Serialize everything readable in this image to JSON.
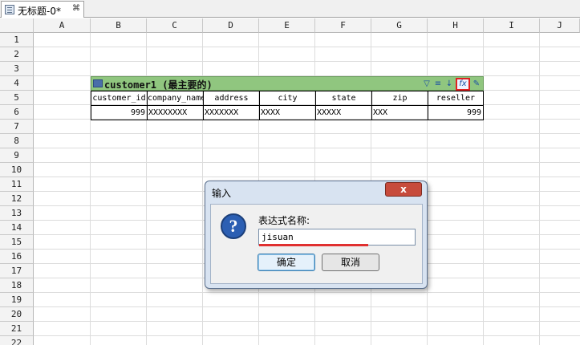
{
  "tab": {
    "title": "无标题-0*",
    "close": "⌘"
  },
  "columns": [
    "A",
    "B",
    "C",
    "D",
    "E",
    "F",
    "G",
    "H",
    "I",
    "J"
  ],
  "rows": [
    "1",
    "2",
    "3",
    "4",
    "5",
    "6",
    "7",
    "8",
    "9",
    "10",
    "11",
    "12",
    "13",
    "14",
    "15",
    "16",
    "17",
    "18",
    "19",
    "20",
    "21",
    "22"
  ],
  "dataset": {
    "title": "customer1 (最主要的)",
    "tools": [
      "filter-icon",
      "list-icon",
      "down-arrow-icon",
      "fx-icon",
      "edit-icon"
    ]
  },
  "table": {
    "headers": [
      "customer_id",
      "company_name",
      "address",
      "city",
      "state",
      "zip",
      "reseller"
    ],
    "row": [
      "999",
      "XXXXXXXX",
      "XXXXXXX",
      "XXXX",
      "XXXXX",
      "XXX",
      "999"
    ]
  },
  "dialog": {
    "title": "输入",
    "close": "x",
    "prompt": "表达式名称:",
    "input_value": "jisuan",
    "ok": "确定",
    "cancel": "取消"
  },
  "colors": {
    "dataset_bar": "#90c67f",
    "highlight": "#e02020",
    "dialog_bg": "#d8e3f1"
  }
}
